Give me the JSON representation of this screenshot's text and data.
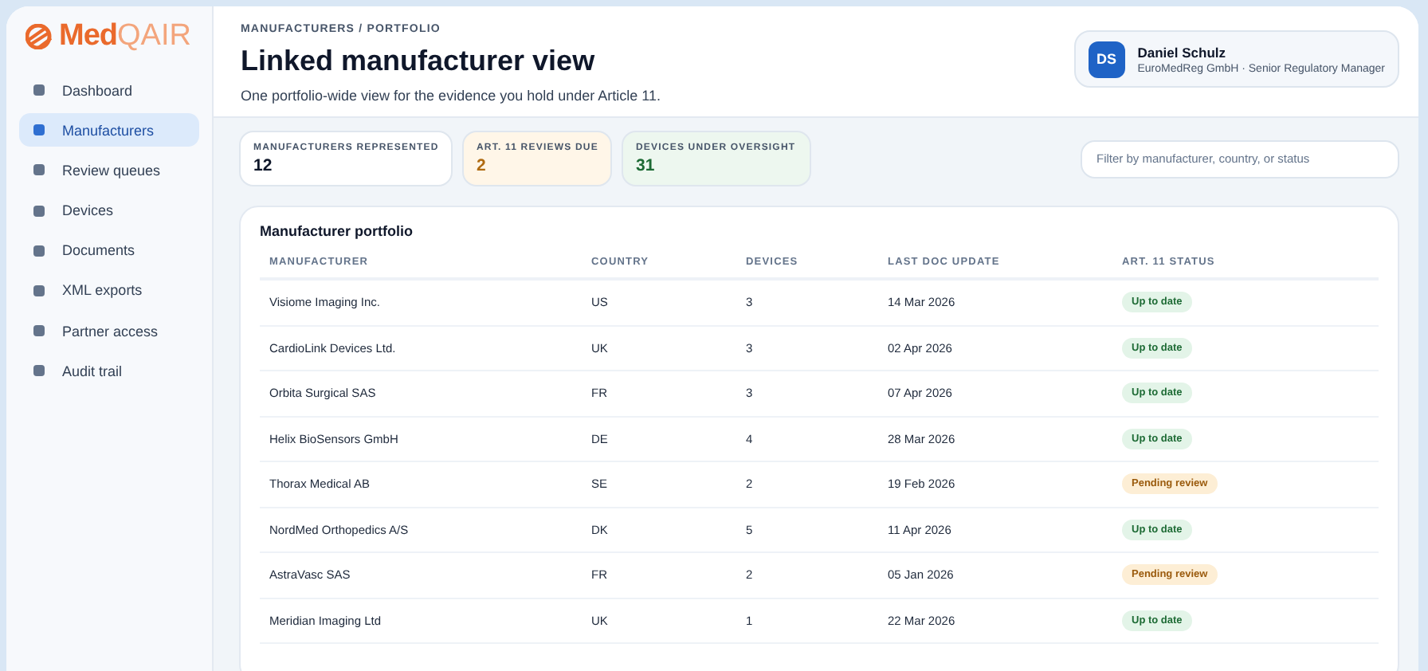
{
  "brand": {
    "part_1": "Med",
    "part_2": "QAIR"
  },
  "sidebar": {
    "items": [
      {
        "label": "Dashboard",
        "selected": false
      },
      {
        "label": "Manufacturers",
        "selected": true
      },
      {
        "label": "Review queues",
        "selected": false
      },
      {
        "label": "Devices",
        "selected": false
      },
      {
        "label": "Documents",
        "selected": false
      },
      {
        "label": "XML exports",
        "selected": false
      },
      {
        "label": "Partner access",
        "selected": false
      },
      {
        "label": "Audit trail",
        "selected": false
      }
    ]
  },
  "header": {
    "breadcrumb": "MANUFACTURERS / PORTFOLIO",
    "title": "Linked manufacturer view",
    "subtitle": "One portfolio-wide view for the evidence you hold under Article 11."
  },
  "user": {
    "initials": "DS",
    "name": "Daniel Schulz",
    "role": "EuroMedReg GmbH · Senior Regulatory Manager"
  },
  "stats": [
    {
      "label": "MANUFACTURERS REPRESENTED",
      "value": "12",
      "kind": "neutral"
    },
    {
      "label": "ART. 11 REVIEWS DUE",
      "value": "2",
      "kind": "warning"
    },
    {
      "label": "DEVICES UNDER OVERSIGHT",
      "value": "31",
      "kind": "success"
    }
  ],
  "filter": {
    "placeholder": "Filter by manufacturer, country, or status"
  },
  "table": {
    "title": "Manufacturer portfolio",
    "columns": [
      "MANUFACTURER",
      "COUNTRY",
      "DEVICES",
      "LAST DOC UPDATE",
      "ART. 11 STATUS"
    ],
    "rows": [
      {
        "cells": [
          "Visiome Imaging Inc.",
          "US",
          "3",
          "14 Mar 2026"
        ],
        "status": "Up to date",
        "kind": "ok"
      },
      {
        "cells": [
          "CardioLink Devices Ltd.",
          "UK",
          "3",
          "02 Apr 2026"
        ],
        "status": "Up to date",
        "kind": "ok"
      },
      {
        "cells": [
          "Orbita Surgical SAS",
          "FR",
          "3",
          "07 Apr 2026"
        ],
        "status": "Up to date",
        "kind": "ok"
      },
      {
        "cells": [
          "Helix BioSensors GmbH",
          "DE",
          "4",
          "28 Mar 2026"
        ],
        "status": "Up to date",
        "kind": "ok"
      },
      {
        "cells": [
          "Thorax Medical AB",
          "SE",
          "2",
          "19 Feb 2026"
        ],
        "status": "Pending review",
        "kind": "pending"
      },
      {
        "cells": [
          "NordMed Orthopedics A/S",
          "DK",
          "5",
          "11 Apr 2026"
        ],
        "status": "Up to date",
        "kind": "ok"
      },
      {
        "cells": [
          "AstraVasc SAS",
          "FR",
          "2",
          "05 Jan 2026"
        ],
        "status": "Pending review",
        "kind": "pending"
      },
      {
        "cells": [
          "Meridian Imaging Ltd",
          "UK",
          "1",
          "22 Mar 2026"
        ],
        "status": "Up to date",
        "kind": "ok"
      }
    ]
  }
}
